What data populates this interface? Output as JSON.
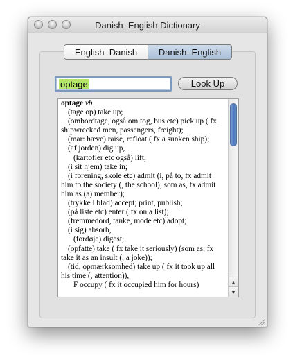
{
  "window": {
    "title": "Danish–English Dictionary"
  },
  "segmented_control": {
    "options": [
      "English–Danish",
      "Danish–English"
    ],
    "selected": "Danish–English"
  },
  "search": {
    "value": "optage"
  },
  "lookup_button": {
    "label": "Look Up"
  },
  "results": {
    "lines": [
      "optage vb",
      "(tage op) take up;",
      "(ombordtage, også om tog, bus etc) pick up ( fx",
      "shipwrecked men, passengers, freight);",
      "(mar: hæve) raise, refloat ( fx a sunken ship);",
      "(af jorden) dig up,",
      "(kartofler etc også) lift;",
      "(i sit hjem) take in;",
      "(i forening, skole etc) admit (i, på to, fx admit",
      "him to the society (, the school); som as, fx admit",
      "him as (a) member);",
      "(trykke i blad) accept; print, publish;",
      "(på liste etc) enter ( fx on a list);",
      "(fremmedord, tanke, mode etc) adopt;",
      "(i sig) absorb,",
      "(fordøje) digest;",
      "(opfatte) take ( fx take it seriously) (som as, fx",
      "take it as an insult (, a joke));",
      "(tid, opmærksomhed) take up ( fx it took up all",
      "his time (, attention)),",
      "F occupy ( fx it occupied him for hours)"
    ]
  },
  "colors": {
    "selection_highlight": "#b4e66a",
    "scroll_thumb": "#4b78bd"
  },
  "icons": {
    "scroll_up": "▲",
    "scroll_down": "▼"
  }
}
